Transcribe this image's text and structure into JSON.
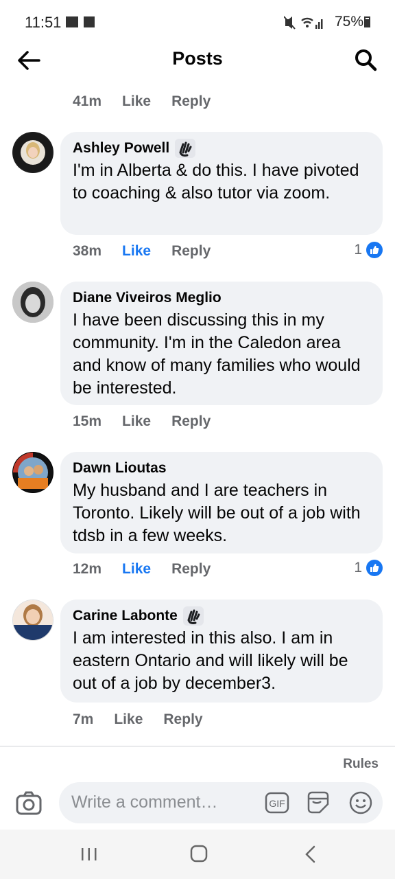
{
  "status": {
    "time": "11:51",
    "battery": "75%"
  },
  "header": {
    "title": "Posts"
  },
  "top_meta": {
    "time": "41m",
    "like": "Like",
    "reply": "Reply"
  },
  "comments": [
    {
      "author": "Ashley Powell",
      "text": "I'm in Alberta & do this. I have pivoted to coaching & also tutor via zoom.",
      "time": "38m",
      "like": "Like",
      "reply": "Reply",
      "reactions": "1"
    },
    {
      "author": "Diane Viveiros Meglio",
      "text": "I have been discussing this in my community.  I'm in the Caledon area and know of many families who would be interested.",
      "time": "15m",
      "like": "Like",
      "reply": "Reply"
    },
    {
      "author": "Dawn Lioutas",
      "text": "My husband and I are teachers in Toronto. Likely will be out of a job with tdsb in a few weeks.",
      "time": "12m",
      "like": "Like",
      "reply": "Reply",
      "reactions": "1"
    },
    {
      "author": "Carine Labonte",
      "text": "I am interested in this also. I am in eastern Ontario and will likely will be out of a job by december3.",
      "time": "7m",
      "like": "Like",
      "reply": "Reply"
    }
  ],
  "footer": {
    "rules": "Rules",
    "placeholder": "Write a comment…",
    "gif": "GIF"
  },
  "colors": {
    "accent": "#1877f2",
    "bubble": "#f0f2f5",
    "meta": "#65676b"
  },
  "icons": [
    "back-arrow-icon",
    "search-icon",
    "wave-badge-icon",
    "like-reaction-icon",
    "camera-icon",
    "gif-icon",
    "sticker-icon",
    "emoji-icon",
    "recents-icon",
    "home-icon",
    "back-nav-icon"
  ]
}
